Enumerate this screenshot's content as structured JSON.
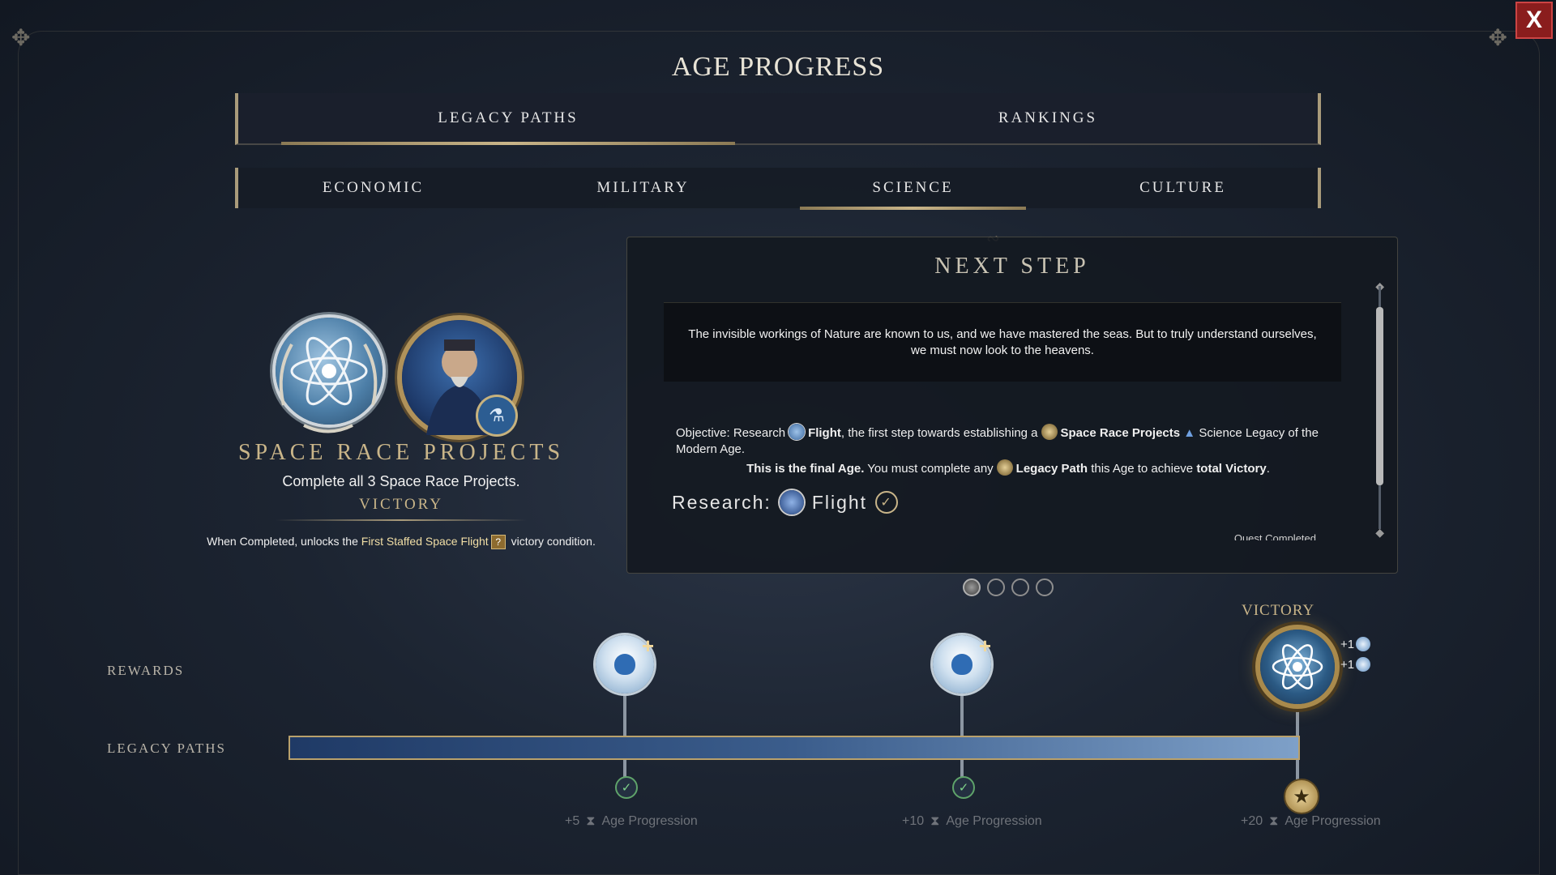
{
  "window": {
    "title": "AGE PROGRESS",
    "close_label": "X"
  },
  "main_tabs": [
    {
      "label": "LEGACY PATHS",
      "active": true
    },
    {
      "label": "RANKINGS",
      "active": false
    }
  ],
  "sub_tabs": [
    {
      "label": "ECONOMIC",
      "active": false
    },
    {
      "label": "MILITARY",
      "active": false
    },
    {
      "label": "SCIENCE",
      "active": true
    },
    {
      "label": "CULTURE",
      "active": false
    }
  ],
  "legacy_path": {
    "title": "SPACE RACE PROJECTS",
    "description": "Complete all 3 Space Race Projects.",
    "victory_label": "VICTORY",
    "unlock_prefix": "When Completed, unlocks the",
    "unlock_highlight": "First Staffed Space Flight",
    "unlock_icon": "?",
    "unlock_suffix": "victory condition."
  },
  "next_step": {
    "title": "NEXT STEP",
    "flavor_text": "The invisible workings of Nature are known to us, and we have mastered the seas. But to truly understand ourselves, we must now look to the heavens.",
    "objective": {
      "prefix": "Objective: Research",
      "tech": "Flight",
      "middle": ", the first step towards establishing a",
      "project": "Space Race Projects",
      "suffix": "Science Legacy of the Modern Age."
    },
    "final_age": {
      "part1": "This is the final Age.",
      "part2": "You must complete any",
      "part3": "Legacy Path",
      "part4": "this Age to achieve",
      "part5": "total Victory",
      "part6": "."
    },
    "research": {
      "label": "Research:",
      "tech": "Flight",
      "check": "✓"
    },
    "quest_status": "Quest Completed"
  },
  "pager": {
    "count": 4,
    "active_index": 0
  },
  "progress_track": {
    "rewards_label": "REWARDS",
    "legacy_paths_label": "LEGACY PATHS",
    "progress_fraction": 1.0,
    "milestones": [
      {
        "amount": "+5",
        "label": "Age Progression",
        "status": "completed",
        "reward_icon": "science-flask-plus-icon"
      },
      {
        "amount": "+10",
        "label": "Age Progression",
        "status": "completed",
        "reward_icon": "science-flask-plus-icon"
      },
      {
        "amount": "+20",
        "label": "Age Progression",
        "status": "victory",
        "reward_icon": "science-victory-emblem-icon"
      }
    ],
    "victory_label": "VICTORY",
    "victory_bonuses": [
      "+1",
      "+1"
    ]
  },
  "colors": {
    "accent_gold": "#c9b589",
    "background": "#1c2431",
    "track_start": "#1f3a66",
    "track_end": "#7ea0c8",
    "close_red": "#8a1d1d"
  }
}
